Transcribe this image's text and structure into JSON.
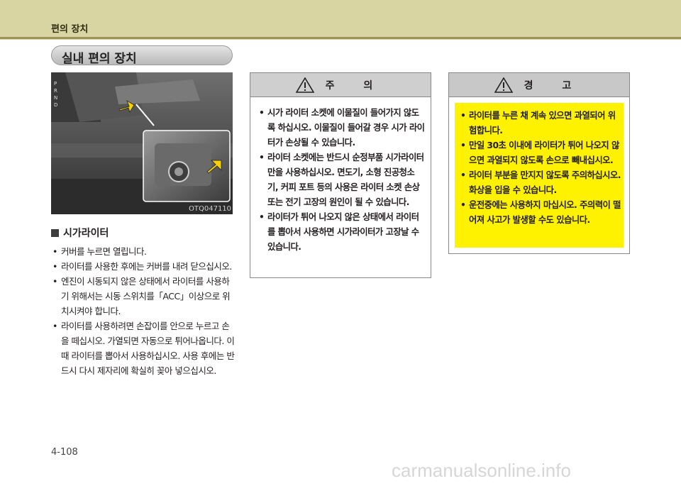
{
  "header": {
    "title": "편의 장치"
  },
  "section": {
    "title": "실내 편의 장치"
  },
  "figure": {
    "code": "OTQ047110",
    "gear_letters": [
      "P",
      "R",
      "N",
      "D"
    ]
  },
  "left": {
    "heading": "시가라이터",
    "bullets": [
      "커버를 누르면 열립니다.",
      "라이터를 사용한 후에는 커버를 내려 닫으십시오.",
      "엔진이 시동되지 않은 상태에서 라이터를 사용하기 위해서는 시동 스위치를「ACC」이상으로 위치시켜야 합니다.",
      "라이터를 사용하려면 손잡이를 안으로 누르고 손을 떼십시오. 가열되면 자동으로 튀어나옵니다. 이때 라이터를 뽑아서 사용하십시오. 사용 후에는 반드시 다시 제자리에 확실히 꽂아 넣으십시오."
    ]
  },
  "caution": {
    "title": "주 의",
    "bullets": [
      "시가 라이터 소켓에 이물질이 들어가지 않도록 하십시오. 이물질이 들어갈 경우 시가 라이터가 손상될 수 있습니다.",
      "라이터 소켓에는 반드시 순정부품 시가라이터만을 사용하십시오. 면도기, 소형 진공청소기, 커피 포트 등의 사용은 라이터 소켓 손상 또는 전기 고장의 원인이 될 수 있습니다.",
      "라이터가 튀어 나오지 않은 상태에서 라이터를 뽑아서 사용하면 시가라이터가 고장날 수 있습니다."
    ]
  },
  "warning": {
    "title": "경 고",
    "bullets": [
      "라이터를 누른 채 계속 있으면 과열되어 위험합니다.",
      "만일 30초 이내에 라이터가 튀어 나오지 않으면 과열되지 않도록 손으로 빼내십시오.",
      "라이터 부분을 만지지 않도록 주의하십시오. 화상을 입을 수 있습니다.",
      "운전중에는 사용하지 마십시오. 주의력이 떨어져 사고가 발생할 수도 있습니다."
    ]
  },
  "footer": {
    "page": "4-108",
    "watermark": "carmanualsonline.info"
  },
  "colors": {
    "header": "#d9d5a3",
    "warning_fill": "#fff200",
    "arrow": "#f5d200"
  }
}
